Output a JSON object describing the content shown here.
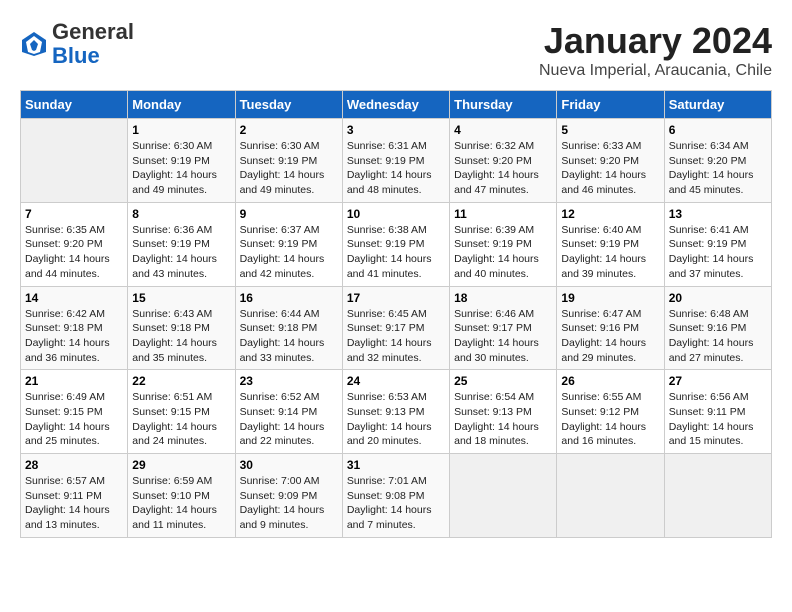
{
  "header": {
    "logo_general": "General",
    "logo_blue": "Blue",
    "month_title": "January 2024",
    "subtitle": "Nueva Imperial, Araucania, Chile"
  },
  "days_of_week": [
    "Sunday",
    "Monday",
    "Tuesday",
    "Wednesday",
    "Thursday",
    "Friday",
    "Saturday"
  ],
  "weeks": [
    [
      {
        "day": "",
        "info": ""
      },
      {
        "day": "1",
        "info": "Sunrise: 6:30 AM\nSunset: 9:19 PM\nDaylight: 14 hours\nand 49 minutes."
      },
      {
        "day": "2",
        "info": "Sunrise: 6:30 AM\nSunset: 9:19 PM\nDaylight: 14 hours\nand 49 minutes."
      },
      {
        "day": "3",
        "info": "Sunrise: 6:31 AM\nSunset: 9:19 PM\nDaylight: 14 hours\nand 48 minutes."
      },
      {
        "day": "4",
        "info": "Sunrise: 6:32 AM\nSunset: 9:20 PM\nDaylight: 14 hours\nand 47 minutes."
      },
      {
        "day": "5",
        "info": "Sunrise: 6:33 AM\nSunset: 9:20 PM\nDaylight: 14 hours\nand 46 minutes."
      },
      {
        "day": "6",
        "info": "Sunrise: 6:34 AM\nSunset: 9:20 PM\nDaylight: 14 hours\nand 45 minutes."
      }
    ],
    [
      {
        "day": "7",
        "info": "Sunrise: 6:35 AM\nSunset: 9:20 PM\nDaylight: 14 hours\nand 44 minutes."
      },
      {
        "day": "8",
        "info": "Sunrise: 6:36 AM\nSunset: 9:19 PM\nDaylight: 14 hours\nand 43 minutes."
      },
      {
        "day": "9",
        "info": "Sunrise: 6:37 AM\nSunset: 9:19 PM\nDaylight: 14 hours\nand 42 minutes."
      },
      {
        "day": "10",
        "info": "Sunrise: 6:38 AM\nSunset: 9:19 PM\nDaylight: 14 hours\nand 41 minutes."
      },
      {
        "day": "11",
        "info": "Sunrise: 6:39 AM\nSunset: 9:19 PM\nDaylight: 14 hours\nand 40 minutes."
      },
      {
        "day": "12",
        "info": "Sunrise: 6:40 AM\nSunset: 9:19 PM\nDaylight: 14 hours\nand 39 minutes."
      },
      {
        "day": "13",
        "info": "Sunrise: 6:41 AM\nSunset: 9:19 PM\nDaylight: 14 hours\nand 37 minutes."
      }
    ],
    [
      {
        "day": "14",
        "info": "Sunrise: 6:42 AM\nSunset: 9:18 PM\nDaylight: 14 hours\nand 36 minutes."
      },
      {
        "day": "15",
        "info": "Sunrise: 6:43 AM\nSunset: 9:18 PM\nDaylight: 14 hours\nand 35 minutes."
      },
      {
        "day": "16",
        "info": "Sunrise: 6:44 AM\nSunset: 9:18 PM\nDaylight: 14 hours\nand 33 minutes."
      },
      {
        "day": "17",
        "info": "Sunrise: 6:45 AM\nSunset: 9:17 PM\nDaylight: 14 hours\nand 32 minutes."
      },
      {
        "day": "18",
        "info": "Sunrise: 6:46 AM\nSunset: 9:17 PM\nDaylight: 14 hours\nand 30 minutes."
      },
      {
        "day": "19",
        "info": "Sunrise: 6:47 AM\nSunset: 9:16 PM\nDaylight: 14 hours\nand 29 minutes."
      },
      {
        "day": "20",
        "info": "Sunrise: 6:48 AM\nSunset: 9:16 PM\nDaylight: 14 hours\nand 27 minutes."
      }
    ],
    [
      {
        "day": "21",
        "info": "Sunrise: 6:49 AM\nSunset: 9:15 PM\nDaylight: 14 hours\nand 25 minutes."
      },
      {
        "day": "22",
        "info": "Sunrise: 6:51 AM\nSunset: 9:15 PM\nDaylight: 14 hours\nand 24 minutes."
      },
      {
        "day": "23",
        "info": "Sunrise: 6:52 AM\nSunset: 9:14 PM\nDaylight: 14 hours\nand 22 minutes."
      },
      {
        "day": "24",
        "info": "Sunrise: 6:53 AM\nSunset: 9:13 PM\nDaylight: 14 hours\nand 20 minutes."
      },
      {
        "day": "25",
        "info": "Sunrise: 6:54 AM\nSunset: 9:13 PM\nDaylight: 14 hours\nand 18 minutes."
      },
      {
        "day": "26",
        "info": "Sunrise: 6:55 AM\nSunset: 9:12 PM\nDaylight: 14 hours\nand 16 minutes."
      },
      {
        "day": "27",
        "info": "Sunrise: 6:56 AM\nSunset: 9:11 PM\nDaylight: 14 hours\nand 15 minutes."
      }
    ],
    [
      {
        "day": "28",
        "info": "Sunrise: 6:57 AM\nSunset: 9:11 PM\nDaylight: 14 hours\nand 13 minutes."
      },
      {
        "day": "29",
        "info": "Sunrise: 6:59 AM\nSunset: 9:10 PM\nDaylight: 14 hours\nand 11 minutes."
      },
      {
        "day": "30",
        "info": "Sunrise: 7:00 AM\nSunset: 9:09 PM\nDaylight: 14 hours\nand 9 minutes."
      },
      {
        "day": "31",
        "info": "Sunrise: 7:01 AM\nSunset: 9:08 PM\nDaylight: 14 hours\nand 7 minutes."
      },
      {
        "day": "",
        "info": ""
      },
      {
        "day": "",
        "info": ""
      },
      {
        "day": "",
        "info": ""
      }
    ]
  ]
}
